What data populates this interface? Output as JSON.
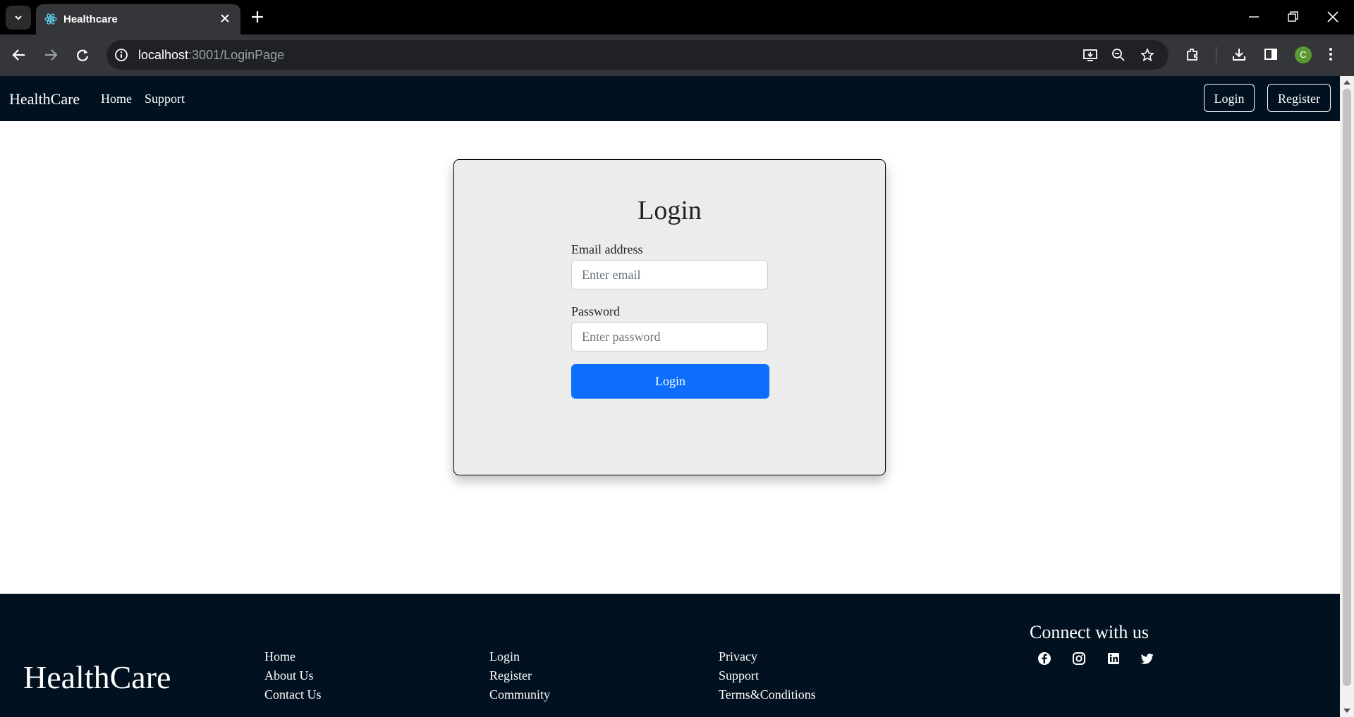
{
  "browser": {
    "tab_title": "Healthcare",
    "url_host": "localhost",
    "url_rest": ":3001/LoginPage",
    "profile_initial": "C",
    "icons": [
      "tab-list-icon",
      "react-favicon-icon",
      "tab-close-icon",
      "new-tab-icon",
      "minimize-icon",
      "restore-icon",
      "window-close-icon",
      "back-icon",
      "forward-icon",
      "reload-icon",
      "site-info-icon",
      "install-app-icon",
      "zoom-icon",
      "bookmark-star-icon",
      "extensions-icon",
      "download-icon",
      "side-panel-icon",
      "more-menu-icon"
    ]
  },
  "navbar": {
    "brand": "HealthCare",
    "links": [
      "Home",
      "Support"
    ],
    "login_label": "Login",
    "register_label": "Register"
  },
  "login": {
    "title": "Login",
    "email_label": "Email address",
    "email_placeholder": "Enter email",
    "email_value": "",
    "password_label": "Password",
    "password_placeholder": "Enter password",
    "password_value": "",
    "submit_label": "Login"
  },
  "footer": {
    "brand": "HealthCare",
    "col1": [
      "Home",
      "About Us",
      "Contact Us"
    ],
    "col2": [
      "Login",
      "Register",
      "Community"
    ],
    "col3": [
      "Privacy",
      "Support",
      "Terms&Conditions"
    ],
    "connect_title": "Connect with us",
    "social_icons": [
      "facebook-icon",
      "instagram-icon",
      "linkedin-icon",
      "twitter-icon"
    ]
  },
  "colors": {
    "nav_bg": "#02111f",
    "primary": "#0d6efd",
    "card_bg": "#ececec"
  }
}
